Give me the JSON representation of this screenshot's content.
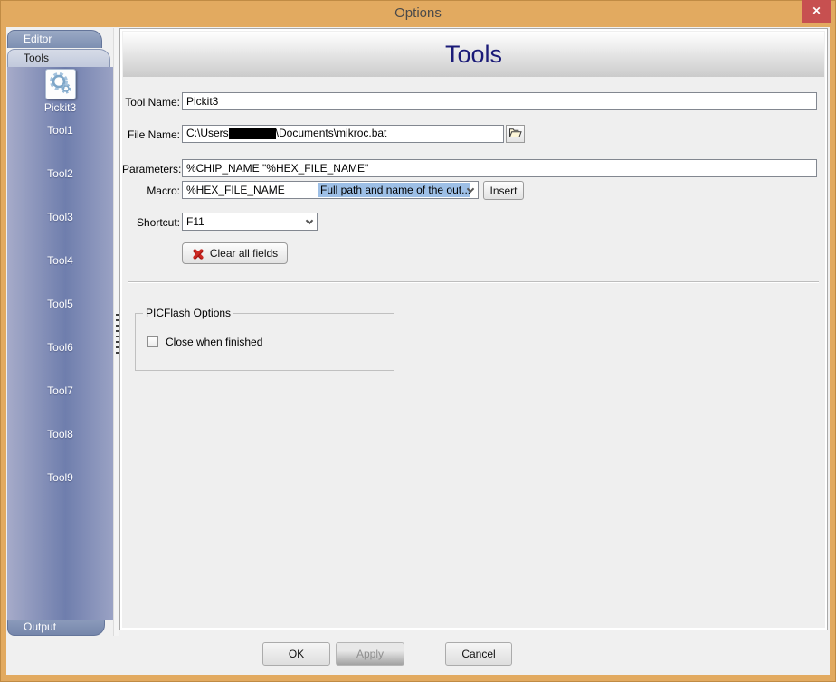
{
  "window": {
    "title": "Options",
    "close_glyph": "✕"
  },
  "sidebar": {
    "editor_tab": "Editor",
    "tools_tab": "Tools",
    "output_tab": "Output",
    "active_tool": "Pickit3",
    "items": [
      {
        "label": "Tool1"
      },
      {
        "label": "Tool2"
      },
      {
        "label": "Tool3"
      },
      {
        "label": "Tool4"
      },
      {
        "label": "Tool5"
      },
      {
        "label": "Tool6"
      },
      {
        "label": "Tool7"
      },
      {
        "label": "Tool8"
      },
      {
        "label": "Tool9"
      }
    ]
  },
  "main": {
    "heading": "Tools",
    "tool_name": {
      "label": "Tool Name:",
      "value": "Pickit3"
    },
    "file_name": {
      "label": "File Name:",
      "prefix": "C:\\Users",
      "suffix": "\\Documents\\mikroc.bat"
    },
    "parameters": {
      "label": "Parameters:",
      "value": "%CHIP_NAME \"%HEX_FILE_NAME\""
    },
    "macro": {
      "label": "Macro:",
      "value": "%HEX_FILE_NAME",
      "description": "Full path and name of the out...",
      "insert_label": "Insert"
    },
    "shortcut": {
      "label": "Shortcut:",
      "value": "F11"
    },
    "clear_label": "Clear all fields",
    "picflash": {
      "title": "PICFlash Options",
      "checkbox": "Close when finished"
    }
  },
  "footer": {
    "ok": "OK",
    "apply": "Apply",
    "cancel": "Cancel"
  },
  "colors": {
    "titlebar": "#e2aa60",
    "close_button": "#c75050",
    "heading": "#1b1b78",
    "macro_highlight": "#9dbfe6",
    "sidebar_dark": "#6f7ead"
  }
}
